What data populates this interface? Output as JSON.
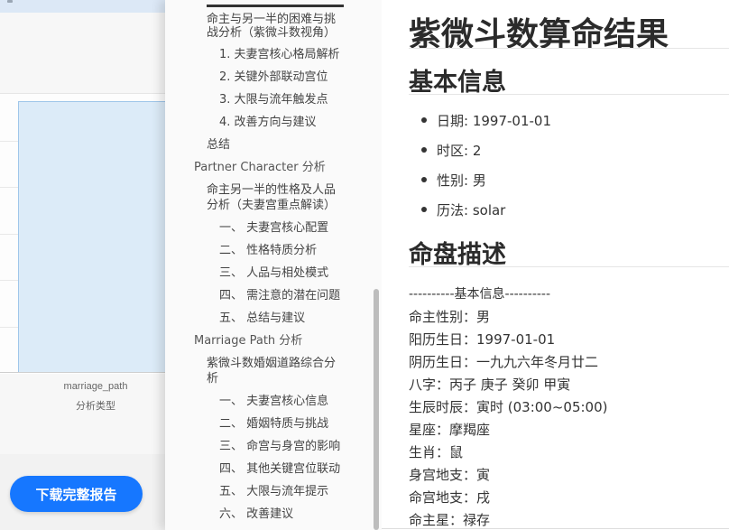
{
  "left_panel": {
    "x_tick_label": "marriage_path",
    "x_axis_label": "分析类型",
    "download_button": "下载完整报告"
  },
  "toc": {
    "items": [
      {
        "text": "命主与另一半的困难与挑",
        "level": 1
      },
      {
        "text": "战分析（紫微斗数视角）",
        "level": 1
      },
      {
        "text": "1. 夫妻宫核心格局解析",
        "level": 2
      },
      {
        "text": "2. 关键外部联动宫位",
        "level": 2
      },
      {
        "text": "3. 大限与流年触发点",
        "level": 2
      },
      {
        "text": "4. 改善方向与建议",
        "level": 2
      },
      {
        "text": "总结",
        "level": 1
      },
      {
        "text": "Partner Character 分析",
        "level": 0
      },
      {
        "text": "命主另一半的性格及人品",
        "level": 1
      },
      {
        "text": "分析（夫妻宫重点解读）",
        "level": 1
      },
      {
        "text": "一、 夫妻宫核心配置",
        "level": 2
      },
      {
        "text": "二、 性格特质分析",
        "level": 2
      },
      {
        "text": "三、 人品与相处模式",
        "level": 2
      },
      {
        "text": "四、 需注意的潜在问题",
        "level": 2
      },
      {
        "text": "五、 总结与建议",
        "level": 2
      },
      {
        "text": "Marriage Path 分析",
        "level": 0
      },
      {
        "text": "紫微斗数婚姻道路综合分",
        "level": 1
      },
      {
        "text": "析",
        "level": 1
      },
      {
        "text": "一、 夫妻宫核心信息",
        "level": 2
      },
      {
        "text": "二、 婚姻特质与挑战",
        "level": 2
      },
      {
        "text": "三、 命宫与身宫的影响",
        "level": 2
      },
      {
        "text": "四、 其他关键宫位联动",
        "level": 2
      },
      {
        "text": "五、 大限与流年提示",
        "level": 2
      },
      {
        "text": "六、 改善建议",
        "level": 2
      }
    ]
  },
  "main": {
    "title": "紫微斗数算命结果",
    "basic_info_heading": "基本信息",
    "basic_info": [
      "日期: 1997-01-01",
      "时区: 2",
      "性别: 男",
      "历法: solar"
    ],
    "chart_desc_heading": "命盘描述",
    "chart_desc_lines": [
      "----------基本信息----------",
      "命主性别：男",
      "阳历生日：1997-01-01",
      "阴历生日：一九九六年冬月廿二",
      "八字：丙子 庚子 癸卯 甲寅",
      "生辰时辰：寅时 (03:00~05:00)",
      "星座：摩羯座",
      "生肖：鼠",
      "身宫地支：寅",
      "命宫地支：戌",
      "命主星：禄存"
    ]
  }
}
